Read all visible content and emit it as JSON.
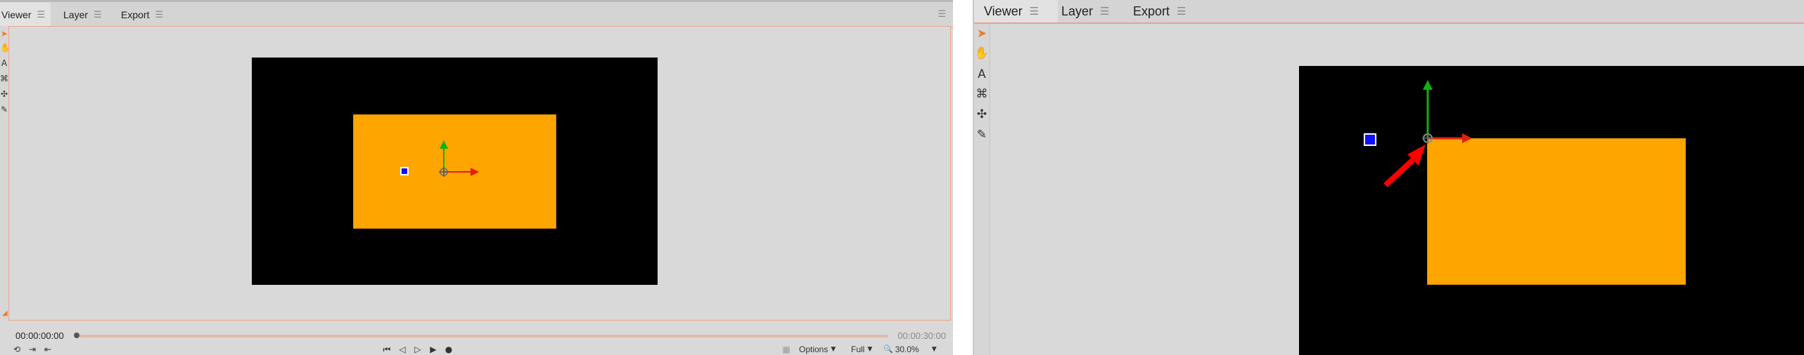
{
  "left_panel": {
    "tabs": [
      {
        "label": "Viewer",
        "active": true
      },
      {
        "label": "Layer",
        "active": false
      },
      {
        "label": "Export",
        "active": false
      }
    ],
    "menu_glyph": "☰",
    "tools": [
      {
        "name": "select-tool",
        "glyph": "➤",
        "selected": true
      },
      {
        "name": "hand-tool",
        "glyph": "✋",
        "selected": false
      },
      {
        "name": "text-tool",
        "glyph": "A",
        "selected": false
      },
      {
        "name": "anchor-tool",
        "glyph": "⌘",
        "selected": false
      },
      {
        "name": "puppet-tool",
        "glyph": "✣",
        "selected": false
      },
      {
        "name": "pen-tool",
        "glyph": "✎",
        "selected": false
      }
    ],
    "transport": {
      "current_time": "00:00:00:00",
      "end_time": "00:00:30:00",
      "playhead_fraction": 0.0,
      "buttons": {
        "loop": "⟲",
        "in_point": "⇥",
        "out_point": "⇤",
        "first_frame": "⏮",
        "prev_frame": "◁",
        "next_frame": "▷",
        "play": "▶",
        "record": "●"
      },
      "options_label": "Options",
      "quality_label": "Full",
      "zoom_label": "30.0%",
      "zoom_icon": "🔍",
      "caret": "▼"
    }
  },
  "right_panel": {
    "tabs": [
      {
        "label": "Viewer",
        "active": true
      },
      {
        "label": "Layer",
        "active": false
      },
      {
        "label": "Export",
        "active": false
      }
    ],
    "menu_glyph": "☰",
    "tools": [
      {
        "name": "select-tool",
        "glyph": "➤",
        "selected": true
      },
      {
        "name": "hand-tool",
        "glyph": "✋",
        "selected": false
      },
      {
        "name": "text-tool",
        "glyph": "A",
        "selected": false
      },
      {
        "name": "anchor-tool",
        "glyph": "⌘",
        "selected": false
      },
      {
        "name": "puppet-tool",
        "glyph": "✣",
        "selected": false
      },
      {
        "name": "pen-tool",
        "glyph": "✎",
        "selected": false
      }
    ]
  },
  "colors": {
    "panel_bg": "#d9d9d9",
    "canvas_bg": "#000000",
    "layer_fill": "#ffa500",
    "anchor_fill": "#1010ff",
    "gizmo_x_axis": "#e02010",
    "gizmo_y_axis": "#10b010",
    "annotation_arrow": "#ff0000",
    "accent": "#f07a28"
  }
}
